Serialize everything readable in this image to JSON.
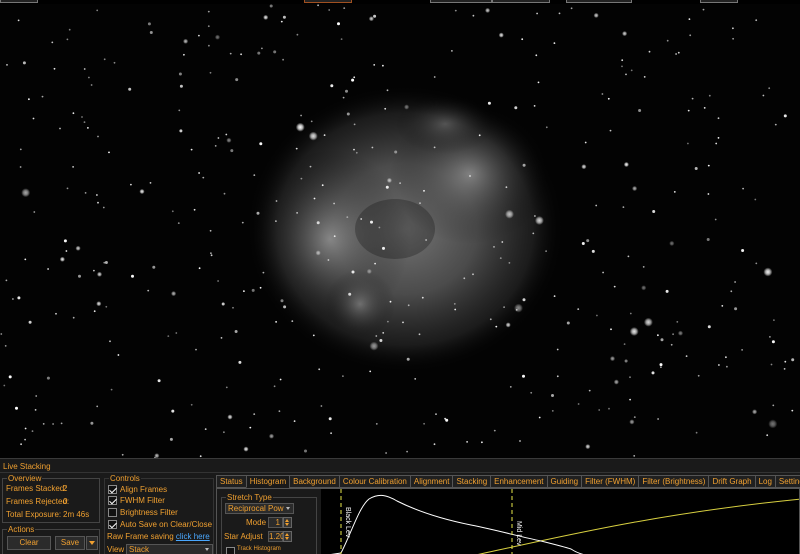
{
  "panel": {
    "title": "Live Stacking"
  },
  "overview": {
    "legend": "Overview",
    "frames_stacked_label": "Frames Stacked:",
    "frames_stacked_value": "2",
    "frames_rejected_label": "Frames Rejected:",
    "frames_rejected_value": "0",
    "total_exposure_label": "Total Exposure:",
    "total_exposure_value": "2m 46s"
  },
  "actions": {
    "legend": "Actions",
    "clear_label": "Clear",
    "save_label": "Save"
  },
  "controls": {
    "legend": "Controls",
    "align_frames": {
      "label": "Align Frames",
      "checked": true
    },
    "fwhm_filter": {
      "label": "FWHM Filter",
      "checked": true
    },
    "brightness_filter": {
      "label": "Brightness Filter",
      "checked": false
    },
    "auto_save": {
      "label": "Auto Save on Clear/Close",
      "checked": true
    },
    "raw_frame_label": "Raw Frame saving",
    "raw_frame_link": "click here",
    "view_label": "View",
    "view_value": "Stack"
  },
  "tabs": [
    "Status",
    "Histogram",
    "Background",
    "Colour Calibration",
    "Alignment",
    "Stacking",
    "Enhancement",
    "Guiding",
    "Filter (FWHM)",
    "Filter (Brightness)",
    "Drift Graph",
    "Log",
    "Settings"
  ],
  "active_tab": "Histogram",
  "stretch": {
    "legend": "Stretch Type",
    "type_value": "Reciprocal Pow",
    "mode_label": "Mode",
    "mode_value": "1",
    "star_adjust_label": "Star Adjust",
    "star_adjust_value": "1.20",
    "track_label": "Track Histogram"
  },
  "histogram": {
    "black_label": "Black Lev",
    "mid_label": "Mid Lev",
    "colors": {
      "curve": "#ffffff",
      "markers": "#e8e84a",
      "transfer": "#d8d040"
    }
  },
  "colors": {
    "accent": "#f0a030",
    "link": "#4aa8ff",
    "panel_bg": "#1a1a1a"
  }
}
